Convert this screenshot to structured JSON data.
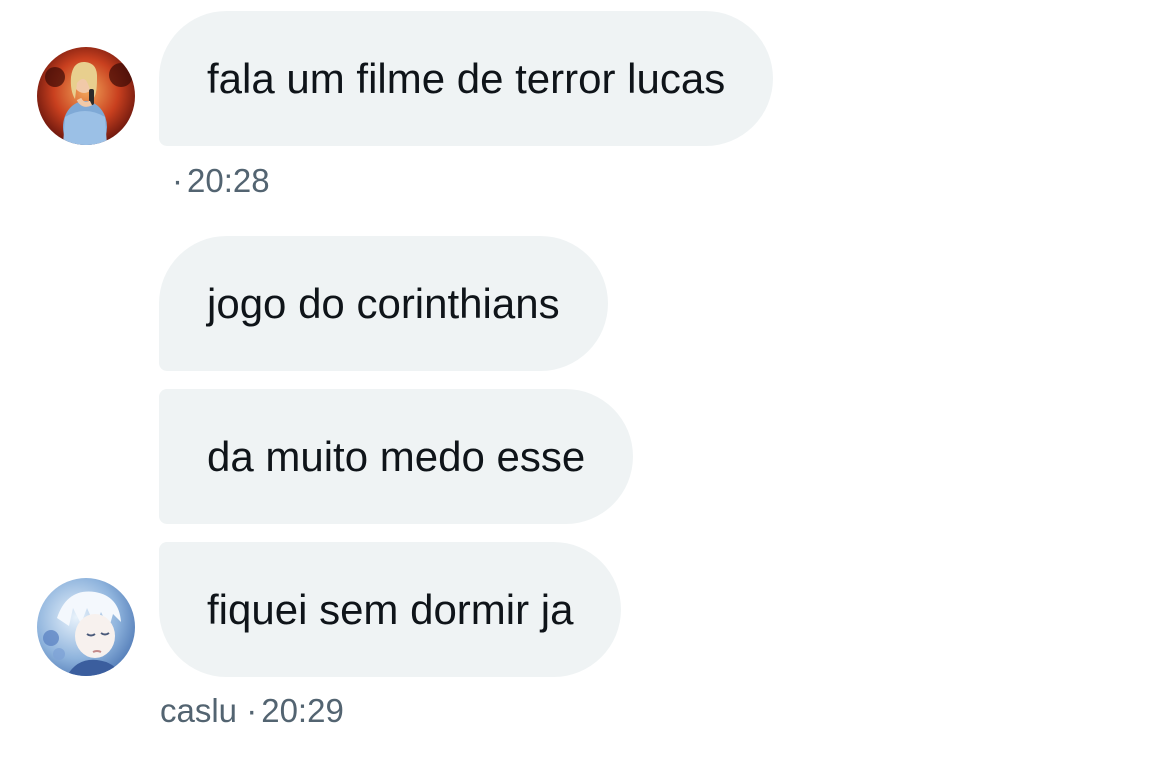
{
  "messages": [
    {
      "text": "fala um filme de terror lucas",
      "avatar": "woman-singing-avatar"
    },
    {
      "text": "jogo do corinthians"
    },
    {
      "text": "da muito medo esse"
    },
    {
      "text": "fiquei sem dormir ja",
      "avatar": "anime-boy-avatar"
    }
  ],
  "meta1": {
    "dot": "·",
    "time": "20:28"
  },
  "meta2": {
    "sender": "caslu",
    "dot": "·",
    "time": "20:29"
  },
  "colors": {
    "bubble": "#eff3f4",
    "text": "#0f1419",
    "meta": "#536471"
  }
}
